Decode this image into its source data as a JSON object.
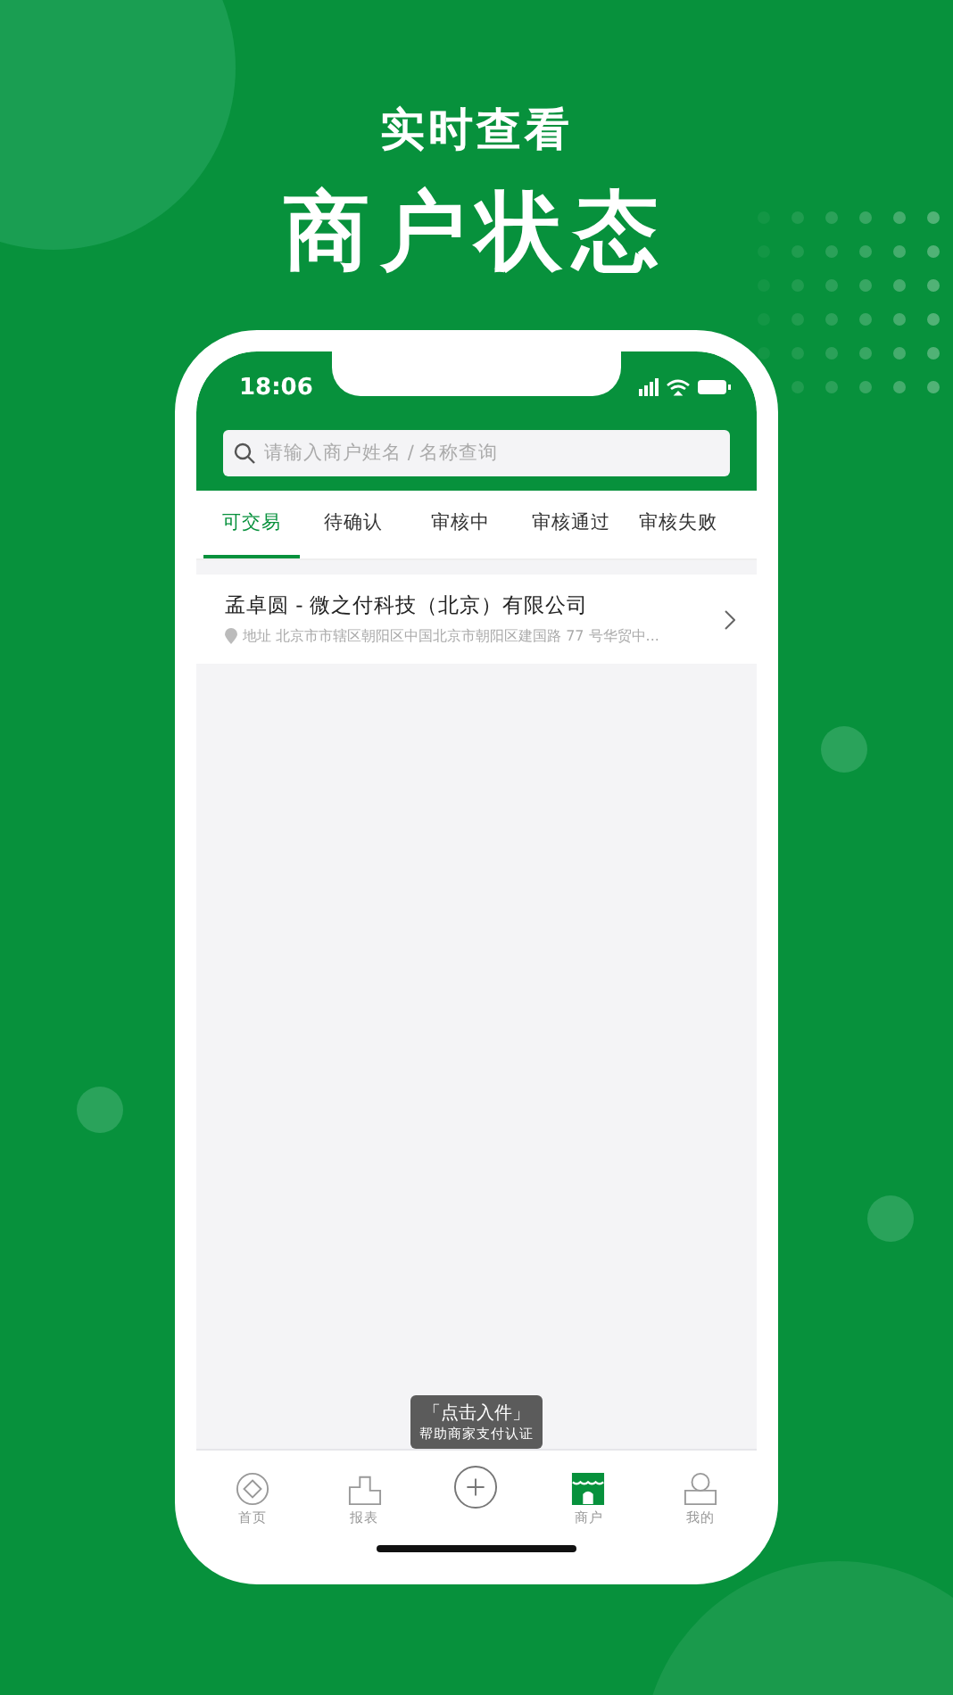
{
  "headline": {
    "subtitle": "实时查看",
    "title": "商户状态"
  },
  "status_bar": {
    "time": "18:06"
  },
  "search": {
    "placeholder": "请输入商户姓名 / 名称查询"
  },
  "tabs": [
    {
      "label": "可交易",
      "selected": true
    },
    {
      "label": "待确认",
      "selected": false
    },
    {
      "label": "审核中",
      "selected": false
    },
    {
      "label": "审核通过",
      "selected": false
    },
    {
      "label": "审核失败",
      "selected": false
    }
  ],
  "merchants": [
    {
      "name": "孟卓圆 - 微之付科技（北京）有限公司",
      "address": "地址 北京市市辖区朝阳区中国北京市朝阳区建国路 77 号华贸中..."
    }
  ],
  "tooltip": {
    "title": "「点击入件」",
    "subtitle": "帮助商家支付认证"
  },
  "nav": [
    {
      "kind": "home",
      "label": "首页",
      "selected": false
    },
    {
      "kind": "report",
      "label": "报表",
      "selected": false
    },
    {
      "kind": "add",
      "selected": false
    },
    {
      "kind": "shop",
      "label": "商户",
      "selected": true
    },
    {
      "kind": "profile",
      "label": "我的",
      "selected": false
    }
  ]
}
